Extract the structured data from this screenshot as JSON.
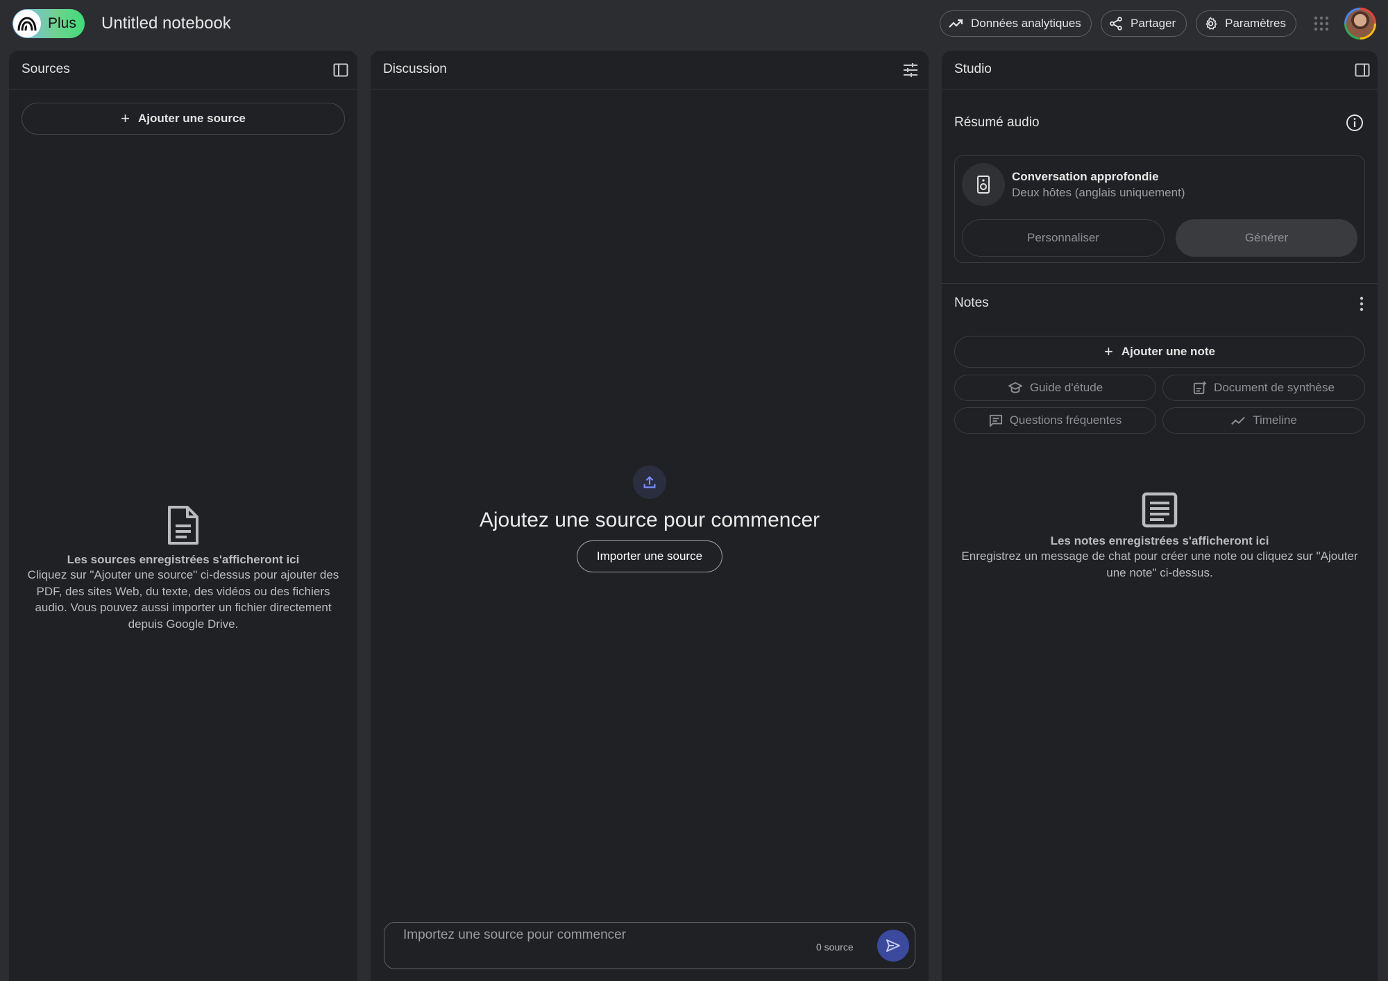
{
  "header": {
    "plan_label": "Plus",
    "notebook_title": "Untitled notebook",
    "analytics_label": "Données analytiques",
    "share_label": "Partager",
    "settings_label": "Paramètres"
  },
  "sources": {
    "title": "Sources",
    "add_source_label": "Ajouter une source",
    "empty_title": "Les sources enregistrées s'afficheront ici",
    "empty_desc": "Cliquez sur \"Ajouter une source\" ci-dessus pour ajouter des PDF, des sites Web, du texte, des vidéos ou des fichiers audio. Vous pouvez aussi importer un fichier directement depuis Google Drive."
  },
  "discussion": {
    "title": "Discussion",
    "empty_title": "Ajoutez une source pour commencer",
    "import_label": "Importer une source",
    "input_placeholder": "Importez une source pour commencer",
    "source_count": "0 source"
  },
  "studio": {
    "title": "Studio",
    "audio_section_title": "Résumé audio",
    "audio_card_title": "Conversation approfondie",
    "audio_card_subtitle": "Deux hôtes (anglais uniquement)",
    "customize_label": "Personnaliser",
    "generate_label": "Générer",
    "notes_title": "Notes",
    "add_note_label": "Ajouter une note",
    "chips": {
      "study_guide": "Guide d'étude",
      "briefing_doc": "Document de synthèse",
      "faq": "Questions fréquentes",
      "timeline": "Timeline"
    },
    "empty_notes_title": "Les notes enregistrées s'afficheront ici",
    "empty_notes_desc": "Enregistrez un message de chat pour créer une note ou cliquez sur \"Ajouter une note\" ci-dessus."
  },
  "colors": {
    "background": "#2c2d31",
    "panel": "#202124",
    "send_button": "#3b4a9e",
    "accent_upload": "#7c8cff"
  },
  "icons": {
    "analytics": "trending-up-icon",
    "share": "share-icon",
    "settings": "gear-icon",
    "apps": "apps-grid-icon",
    "sources_panel_toggle": "panel-left-icon",
    "discussion_settings": "tune-icon",
    "studio_panel_toggle": "panel-right-icon",
    "audio_info": "info-icon",
    "speaker": "speaker-icon",
    "notes_menu": "more-vert-icon",
    "empty_source": "document-icon",
    "upload": "upload-icon",
    "send": "send-icon",
    "empty_notes": "notes-icon"
  }
}
